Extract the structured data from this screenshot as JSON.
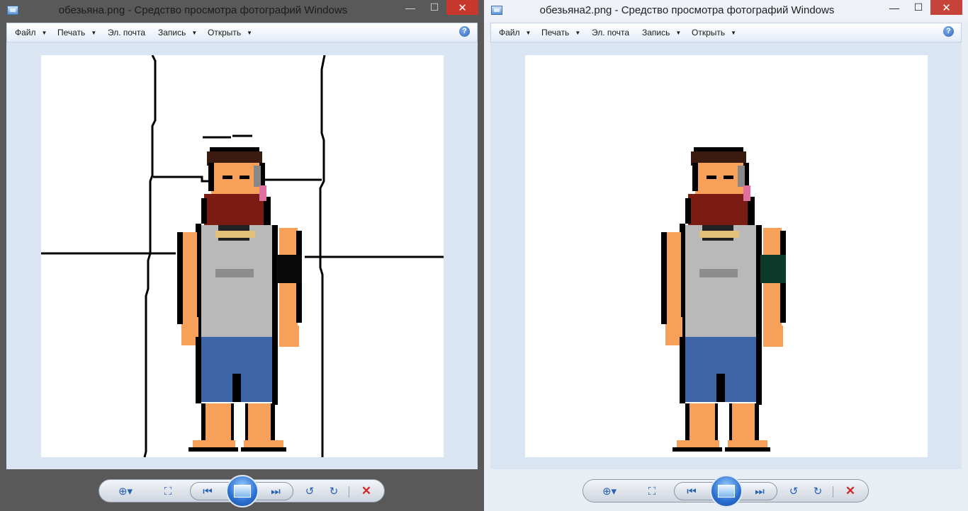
{
  "windows": [
    {
      "title": "обезьяна.png - Средство просмотра фотографий Windows",
      "menu": [
        "Файл",
        "Печать",
        "Эл. почта",
        "Запись",
        "Открыть"
      ],
      "menu_has_dropdown": [
        true,
        true,
        false,
        true,
        true
      ],
      "help_label": "?"
    },
    {
      "title": "обезьяна2.png - Средство просмотра фотографий Windows",
      "menu": [
        "Файл",
        "Печать",
        "Эл. почта",
        "Запись",
        "Открыть"
      ],
      "menu_has_dropdown": [
        true,
        true,
        false,
        true,
        true
      ],
      "help_label": "?"
    }
  ],
  "caption_buttons": {
    "minimize": "—",
    "maximize": "☐",
    "close": "✕"
  },
  "toolbar": {
    "zoom_icon": "zoom-icon",
    "fit_icon": "actual-size-icon",
    "prev_icon": "previous-icon",
    "slideshow_icon": "slideshow-icon",
    "next_icon": "next-icon",
    "rotate_left_icon": "rotate-left-icon",
    "rotate_right_icon": "rotate-right-icon",
    "delete_icon": "delete-icon"
  },
  "colors": {
    "skin": "#f7a05a",
    "shirt": "#b9b9b9",
    "shorts": "#3e64a8",
    "beard": "#7a1b14",
    "hair": "#3b1a10",
    "armband_left": "#0a0a0a",
    "armband_right": "#0e3a2c"
  }
}
